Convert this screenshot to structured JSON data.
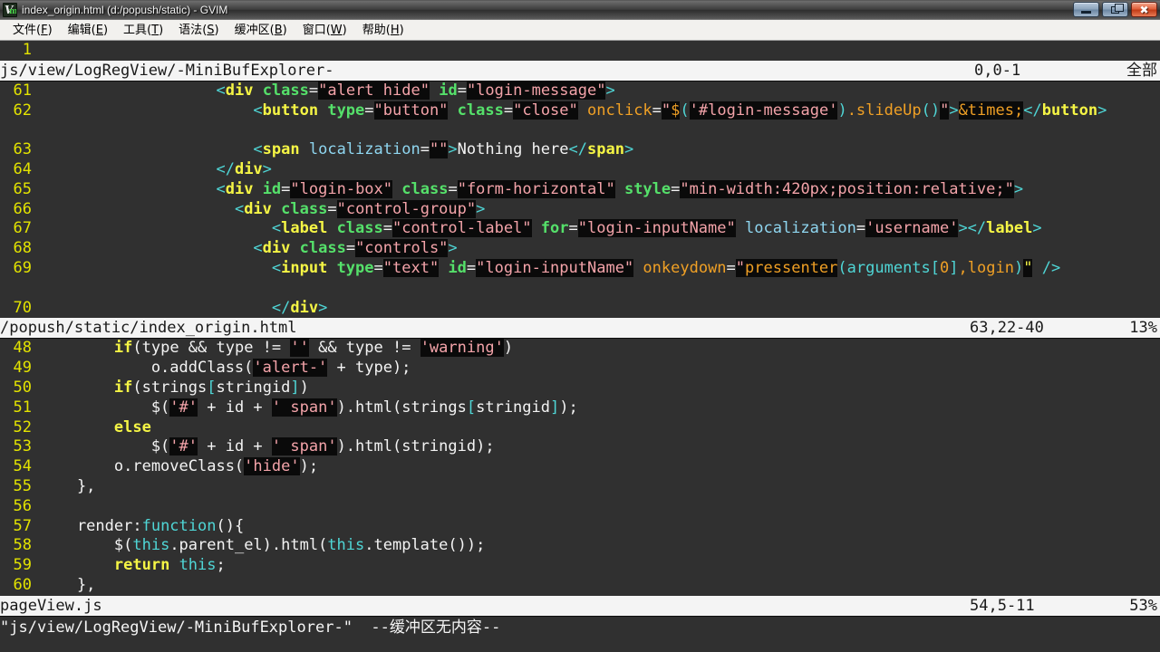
{
  "window": {
    "title": "index_origin.html (d:/popush/static) - GVIM",
    "icon": "gvim-icon",
    "buttons": {
      "minimize": "minimize-icon",
      "restore": "restore-icon",
      "close": "✖"
    }
  },
  "menubar": {
    "items": [
      {
        "label": "文件",
        "accel": "F"
      },
      {
        "label": "编辑",
        "accel": "E"
      },
      {
        "label": "工具",
        "accel": "T"
      },
      {
        "label": "语法",
        "accel": "S"
      },
      {
        "label": "缓冲区",
        "accel": "B"
      },
      {
        "label": "窗口",
        "accel": "W"
      },
      {
        "label": "帮助",
        "accel": "H"
      }
    ]
  },
  "windows": [
    {
      "name": "minibufexplorer",
      "lines": [
        {
          "num": "1",
          "text": ""
        }
      ],
      "status": {
        "name": "js/view/LogRegView/-MiniBufExplorer-",
        "position": "0,0-1",
        "percent": "全部"
      }
    },
    {
      "name": "html-buffer",
      "lines": [
        {
          "num": "61",
          "text": "                   <div class=\"alert hide\" id=\"login-message\">"
        },
        {
          "num": "62",
          "text": "                       <button type=\"button\" class=\"close\" onclick=\"$('#login-message').slideUp()\">&times;</button>"
        },
        {
          "num": "63",
          "text": "                       <span localization=\"\">Nothing here</span>"
        },
        {
          "num": "64",
          "text": "                   </div>"
        },
        {
          "num": "65",
          "text": "                   <div id=\"login-box\" class=\"form-horizontal\" style=\"min-width:420px;position:relative;\">"
        },
        {
          "num": "66",
          "text": "                     <div class=\"control-group\">"
        },
        {
          "num": "67",
          "text": "                         <label class=\"control-label\" for=\"login-inputName\" localization='username'></label>"
        },
        {
          "num": "68",
          "text": "                       <div class=\"controls\">"
        },
        {
          "num": "69",
          "text": "                         <input type=\"text\" id=\"login-inputName\" onkeydown=\"pressenter(arguments[0],login)\" />"
        },
        {
          "num": "70",
          "text": "                         </div>"
        }
      ],
      "status": {
        "name": "/popush/static/index_origin.html",
        "position": "63,22-40",
        "percent": "13%"
      }
    },
    {
      "name": "js-buffer",
      "lines": [
        {
          "num": "48",
          "text": "        if(type && type != '' && type != 'warning')"
        },
        {
          "num": "49",
          "text": "            o.addClass('alert-' + type);"
        },
        {
          "num": "50",
          "text": "        if(strings[stringid])"
        },
        {
          "num": "51",
          "text": "            $('#' + id + ' span').html(strings[stringid]);"
        },
        {
          "num": "52",
          "text": "        else"
        },
        {
          "num": "53",
          "text": "            $('#' + id + ' span').html(stringid);"
        },
        {
          "num": "54",
          "text": "        o.removeClass('hide');"
        },
        {
          "num": "55",
          "text": "    },"
        },
        {
          "num": "56",
          "text": ""
        },
        {
          "num": "57",
          "text": "    render:function(){"
        },
        {
          "num": "58",
          "text": "        $(this.parent_el).html(this.template());"
        },
        {
          "num": "59",
          "text": "        return this;"
        },
        {
          "num": "60",
          "text": "    },"
        }
      ],
      "status": {
        "name": "pageView.js",
        "position": "54,5-11",
        "percent": "53%"
      }
    }
  ],
  "commandline": {
    "message": "\"js/view/LogRegView/-MiniBufExplorer-\"  --缓冲区无内容--"
  },
  "colors": {
    "editor_bg": "#303030",
    "linenr": "#e3e300",
    "tag": "#f5f545",
    "attribute": "#55e06a",
    "string": "#f3a3a9",
    "keyword": "#f5f545",
    "function": "#4fd6d6",
    "event_attr": "#f0a025",
    "statusline_bg": "#f4f4f4",
    "statusline_fg": "#1a1a1a"
  }
}
